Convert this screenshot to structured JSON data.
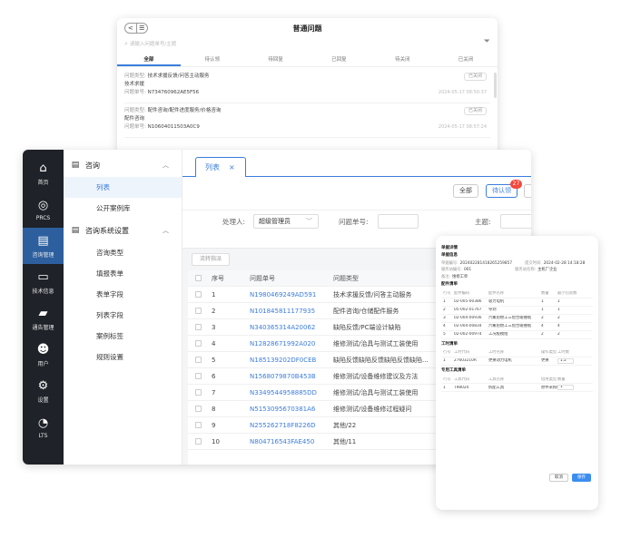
{
  "issue_list": {
    "title": "普通问题",
    "nav_back": "<",
    "nav_menu": "☰",
    "search_placeholder": "请输入问题单号/主题",
    "tabs": [
      "全部",
      "待认领",
      "待回复",
      "已回复",
      "待关闭",
      "已关闭"
    ],
    "items": [
      {
        "type_label": "问题类型:",
        "type_value": "技术求援反馈/问答主动服务",
        "subject": "技术求援",
        "no_label": "问题单号:",
        "no_value": "N734760962AE5F56",
        "badge": "已关闭",
        "time": "2024-05-17 08:50:37"
      },
      {
        "type_label": "问题类型:",
        "type_value": "配件咨询/配件进度服务/价格咨询",
        "subject": "配件咨询",
        "no_label": "问题单号:",
        "no_value": "N10604011503A0C9",
        "badge": "已关闭",
        "time": "2024-05-17 08:57:24"
      }
    ]
  },
  "left_nav": [
    {
      "label": "首页",
      "icon": "home-icon",
      "glyph": "⌂"
    },
    {
      "label": "PRCS",
      "icon": "prcs-icon",
      "glyph": "◎"
    },
    {
      "label": "咨询管理",
      "icon": "consult-icon",
      "glyph": "▤"
    },
    {
      "label": "技术信息",
      "icon": "monitor-icon",
      "glyph": "▭"
    },
    {
      "label": "通告管理",
      "icon": "notice-icon",
      "glyph": "▰"
    },
    {
      "label": "用户",
      "icon": "user-icon",
      "glyph": "☻"
    },
    {
      "label": "设置",
      "icon": "gear-icon",
      "glyph": "⚙"
    },
    {
      "label": "LTS",
      "icon": "lts-icon",
      "glyph": "◔"
    }
  ],
  "side_menu": {
    "group1": "咨询",
    "group1_items": [
      "列表",
      "公开案例库"
    ],
    "group2": "咨询系统设置",
    "group2_items": [
      "咨询类型",
      "填报表单",
      "表单字段",
      "列表字段",
      "案例标签",
      "规则设置"
    ]
  },
  "content": {
    "tab_label": "列表",
    "tab_close": "×",
    "btn_all": "全部",
    "btn_pending": "待认领",
    "pending_count": "27",
    "filter_handler_label": "处理人:",
    "filter_handler_value": "超级管理员",
    "filter_no_label": "问题单号:",
    "filter_subject_label": "主题:",
    "tool_btn": "流转指派"
  },
  "table": {
    "headers": [
      "序号",
      "问题单号",
      "问题类型"
    ],
    "rows": [
      [
        "1",
        "N1980469249AD591",
        "技术求援反馈/问答主动服务"
      ],
      [
        "2",
        "N101845811177935",
        "配件咨询/仓储配件服务"
      ],
      [
        "3",
        "N340365314A20062",
        "缺陷反馈/PC端设计缺陷"
      ],
      [
        "4",
        "N12828671992A020",
        "维修测试/治具与测试工装使用"
      ],
      [
        "5",
        "N185139202DF0CEB",
        "缺陷反馈缺陷反馈缺陷反馈缺陷..."
      ],
      [
        "6",
        "N1568079870B453B",
        "维修测试/设备维修建议及方法"
      ],
      [
        "7",
        "N3349544958885DD",
        "维修测试/治具与测试工装使用"
      ],
      [
        "8",
        "N5153095670381A6",
        "维修测试/设备维修过程疑问"
      ],
      [
        "9",
        "N255262718F8226D",
        "其他/22"
      ],
      [
        "10",
        "N804716543FAE450",
        "其他/11"
      ]
    ]
  },
  "detail": {
    "title": "单据详情",
    "section1": "单据信息",
    "fields": [
      {
        "k": "单据编号:",
        "v": "202402281418265259857",
        "k2": "提交时间:",
        "v2": "2024-02-28 14:18:28"
      },
      {
        "k": "服务站编号:",
        "v": "001",
        "k2": "服务站名称:",
        "v2": "主机厂企业"
      },
      {
        "k": "备注:",
        "v": "维修工单",
        "k2": "",
        "v2": ""
      }
    ],
    "parts_title": "配件清单",
    "parts_headers": [
      "行号",
      "配件编码",
      "配件名称",
      "数量",
      "最小包装数"
    ],
    "parts": [
      [
        "1",
        "02-005-00386",
        "吸力电机",
        "1",
        "1"
      ],
      [
        "2",
        "05-002-01767",
        "导洞",
        "1",
        "1"
      ],
      [
        "3",
        "02-004-00936",
        "六氟阻燃工三组合碰撞板",
        "2",
        "2"
      ],
      [
        "4",
        "02-004-00834",
        "六氟阻燃工三组合碰撞板",
        "4",
        "4"
      ],
      [
        "5",
        "02-002-00974",
        "工况板模组",
        "2",
        "2"
      ]
    ],
    "hours_title": "工时清单",
    "hours_headers": [
      "行号",
      "工时代码",
      "工时名称",
      "操作类型",
      "工时数"
    ],
    "hours": [
      [
        "1",
        "27603210R",
        "更换动力电机",
        "更换",
        "1.2"
      ]
    ],
    "tools_title": "专用工具清单",
    "tools_headers": [
      "行号",
      "工具代码",
      "工具名称",
      "借用类型",
      "数量"
    ],
    "tools": [
      [
        "1",
        "T98024",
        "拆配工具",
        "原件采购件",
        "1"
      ]
    ],
    "btn_cancel": "取消",
    "btn_save": "保存"
  }
}
